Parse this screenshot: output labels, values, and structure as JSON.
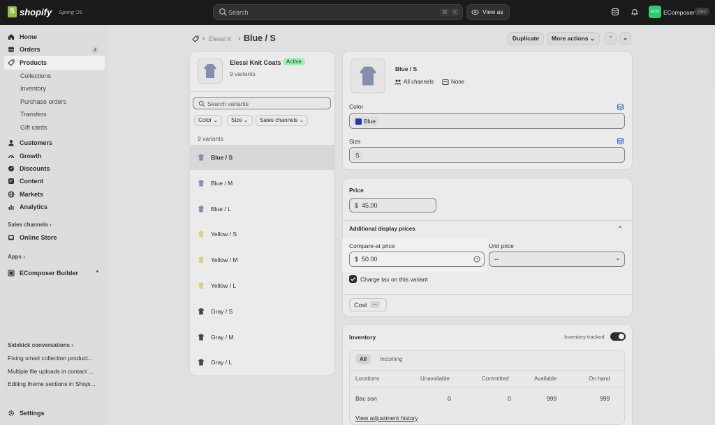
{
  "topbar": {
    "logo_text": "shopify",
    "logo_badge": "Spring '26",
    "search_placeholder": "Search",
    "kbd_cmd": "⌘",
    "kbd_k": "K",
    "view_as": "View as",
    "store_initials": "ECO",
    "store_name": "EComposer",
    "env_badge": "dev"
  },
  "sidebar": {
    "items": [
      {
        "label": "Home",
        "icon": "home-icon"
      },
      {
        "label": "Orders",
        "icon": "orders-icon",
        "badge": "4"
      },
      {
        "label": "Products",
        "icon": "tag-icon"
      },
      {
        "label": "Customers",
        "icon": "person-icon"
      },
      {
        "label": "Growth",
        "icon": "growth-icon"
      },
      {
        "label": "Discounts",
        "icon": "discount-icon"
      },
      {
        "label": "Content",
        "icon": "content-icon"
      },
      {
        "label": "Markets",
        "icon": "globe-icon"
      },
      {
        "label": "Analytics",
        "icon": "analytics-icon"
      }
    ],
    "product_subitems": [
      "Collections",
      "Inventory",
      "Purchase orders",
      "Transfers",
      "Gift cards"
    ],
    "sales_channels_heading": "Sales channels",
    "online_store": "Online Store",
    "apps_heading": "Apps",
    "app_item": "EComposer Builder",
    "sidekick_heading": "Sidekick conversations",
    "sidekick_items": [
      "Fixing smart collection product...",
      "Multiple file uploads in contact ...",
      "Editing theme sections in Shopi..."
    ],
    "settings": "Settings"
  },
  "header": {
    "breadcrumb_parent": "Elessi K",
    "title": "Blue / S",
    "duplicate": "Duplicate",
    "more_actions": "More actions"
  },
  "product_card": {
    "name": "Elessi Knit Coats",
    "status": "Active",
    "variant_count": "9 variants",
    "search_placeholder": "Search variants",
    "filters": [
      "Color",
      "Size",
      "Sales channels"
    ],
    "list_count": "9 variants",
    "variants": [
      {
        "label": "Blue / S",
        "color": "#8a98b8"
      },
      {
        "label": "Blue / M",
        "color": "#8a98b8"
      },
      {
        "label": "Blue / L",
        "color": "#8a98b8"
      },
      {
        "label": "Yellow / S",
        "color": "#e8df86"
      },
      {
        "label": "Yellow / M",
        "color": "#e8df86"
      },
      {
        "label": "Yellow / L",
        "color": "#e8df86"
      },
      {
        "label": "Gray / S",
        "color": "#4a4a4a"
      },
      {
        "label": "Gray / M",
        "color": "#4a4a4a"
      },
      {
        "label": "Gray / L",
        "color": "#4a4a4a"
      }
    ]
  },
  "variant_card": {
    "title": "Blue / S",
    "channels": "All channels",
    "catalog": "None",
    "color_label": "Color",
    "color_value": "Blue",
    "size_label": "Size",
    "size_value": "S"
  },
  "pricing": {
    "price_label": "Price",
    "currency": "$",
    "price": "45.00",
    "additional_heading": "Additional display prices",
    "compare_label": "Compare-at price",
    "compare_value": "50.00",
    "unit_label": "Unit price",
    "unit_value": "--",
    "charge_tax": "Charge tax on this variant",
    "cost_label": "Cost",
    "cost_value": "--"
  },
  "inventory": {
    "heading": "Inventory",
    "tracked_label": "Inventory tracked",
    "tabs": [
      "All",
      "Incoming"
    ],
    "columns": [
      "Locations",
      "Unavailable",
      "Committed",
      "Available",
      "On hand"
    ],
    "row": [
      "Bac son",
      "0",
      "0",
      "999",
      "999"
    ],
    "history_link": "View adjustment history"
  },
  "colors": {
    "accent_green": "#95bf47",
    "active_badge": "#affebf",
    "blue_swatch": "#1f3fb0"
  }
}
